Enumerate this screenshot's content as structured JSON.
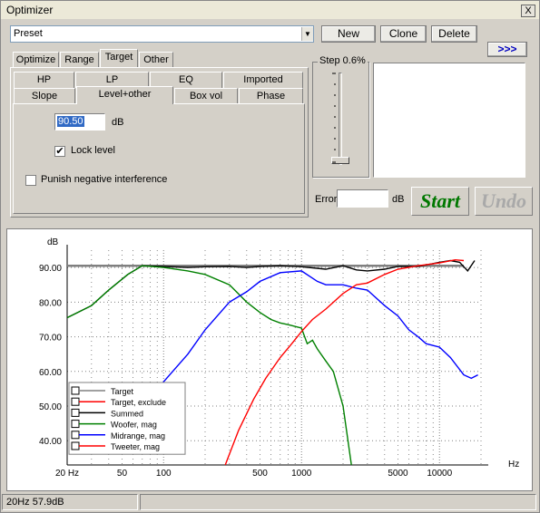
{
  "window": {
    "title": "Optimizer",
    "close": "X"
  },
  "preset": {
    "value": "Preset"
  },
  "buttons": {
    "new": "New",
    "clone": "Clone",
    "delete": "Delete",
    "expand": ">>>",
    "start": "Start",
    "undo": "Undo"
  },
  "tabs_top": [
    "Optimize",
    "Range",
    "Target",
    "Other"
  ],
  "tabs_row1": [
    "HP",
    "LP",
    "EQ",
    "Imported"
  ],
  "tabs_row2": [
    "Slope",
    "Level+other",
    "Box vol",
    "Phase"
  ],
  "level": {
    "value": "90.50",
    "unit": "dB"
  },
  "lock_level": {
    "label": "Lock level",
    "checked": true
  },
  "punish": {
    "label": "Punish negative interference",
    "checked": false
  },
  "step": {
    "label": "Step 0.6%"
  },
  "error": {
    "label": "Error",
    "value": "",
    "unit": "dB"
  },
  "status": {
    "left": "20Hz 57.9dB",
    "right": ""
  },
  "colors": {
    "target": "#000000",
    "target_exclude": "#ff0000",
    "summed": "#000000",
    "woofer": "#008000",
    "midrange": "#0000ff",
    "tweeter": "#ff0000",
    "start_text": "#007800",
    "undo_text": "#a9a9a9"
  },
  "chart_data": {
    "type": "line",
    "xlabel": "Hz",
    "ylabel": "dB",
    "xscale": "log",
    "xlim": [
      20,
      20000
    ],
    "ylim": [
      33,
      95
    ],
    "xticks": [
      20,
      50,
      100,
      500,
      1000,
      5000,
      10000
    ],
    "xtick_labels": [
      "20 Hz",
      "50",
      "100",
      "500",
      "1000",
      "5000",
      "10000"
    ],
    "yticks": [
      40,
      50,
      60,
      70,
      80,
      90
    ],
    "ytick_labels": [
      "40.00",
      "50.00",
      "60.00",
      "70.00",
      "80.00",
      "90.00"
    ],
    "grid": true,
    "legend_position": "bottom-left",
    "series": [
      {
        "name": "Target",
        "color": "#808080",
        "x": [
          20,
          15000
        ],
        "y": [
          90.5,
          90.5
        ]
      },
      {
        "name": "Target, exclude",
        "color": "#ff0000",
        "x": [],
        "y": []
      },
      {
        "name": "Summed",
        "color": "#000000",
        "x": [
          20,
          30,
          40,
          55,
          70,
          100,
          150,
          200,
          300,
          400,
          500,
          700,
          1000,
          1500,
          2000,
          2500,
          3000,
          4000,
          5000,
          7000,
          10000,
          12000,
          14000,
          16000,
          18000
        ],
        "y": [
          75.5,
          79,
          83.5,
          88,
          90.5,
          90.3,
          90,
          90.2,
          90.3,
          90,
          90.3,
          90.5,
          90.2,
          89.5,
          90.5,
          89.3,
          89,
          89.5,
          90.3,
          90.3,
          91.5,
          92,
          91.5,
          89,
          92
        ]
      },
      {
        "name": "Woofer, mag",
        "color": "#008000",
        "x": [
          20,
          30,
          40,
          55,
          70,
          100,
          150,
          200,
          300,
          400,
          500,
          600,
          700,
          800,
          1000,
          1100,
          1200,
          1300,
          1500,
          1700,
          2000,
          2300
        ],
        "y": [
          75.5,
          79,
          83.5,
          88,
          90.5,
          90,
          89,
          88,
          85,
          80,
          77,
          75,
          74,
          73.5,
          72.5,
          68,
          69,
          66.5,
          63,
          60,
          50,
          33
        ]
      },
      {
        "name": "Midrange, mag",
        "color": "#0000ff",
        "x": [
          55,
          70,
          100,
          150,
          200,
          300,
          400,
          500,
          700,
          1000,
          1300,
          1500,
          2000,
          2500,
          3000,
          4000,
          5000,
          6000,
          7000,
          8000,
          10000,
          12000,
          15000,
          17000,
          19000
        ],
        "y": [
          43,
          49,
          57,
          65,
          72,
          80,
          83,
          86,
          88.5,
          89,
          86,
          85,
          85,
          84,
          83.5,
          79,
          76,
          72,
          70,
          68,
          67,
          64,
          59,
          58,
          59
        ]
      },
      {
        "name": "Tweeter, mag",
        "color": "#ff0000",
        "x": [
          280,
          350,
          450,
          550,
          700,
          850,
          1000,
          1200,
          1500,
          2000,
          2500,
          3000,
          4000,
          5000,
          7000,
          10000,
          13000,
          15000
        ],
        "y": [
          33,
          43,
          52,
          58,
          64,
          68,
          71.5,
          75,
          78,
          82.5,
          85,
          85.5,
          88,
          89.5,
          90.5,
          91.3,
          92.2,
          92
        ]
      }
    ]
  }
}
